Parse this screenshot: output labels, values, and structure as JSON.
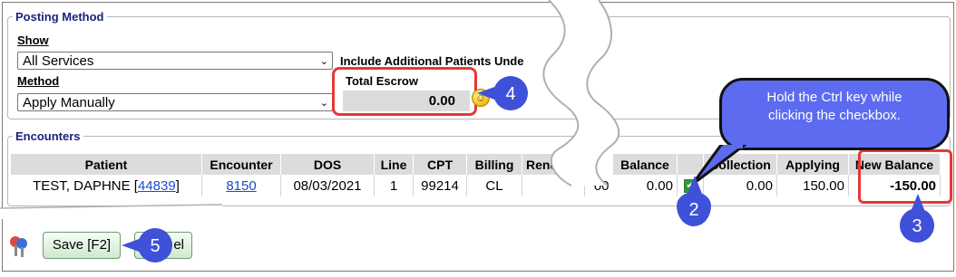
{
  "posting_method": {
    "legend": "Posting Method",
    "show_label": "Show",
    "show_value": "All Services",
    "method_label": "Method",
    "method_value": "Apply Manually",
    "include_label": "Include Additional Patients Unde",
    "total_escrow_label": "Total Escrow",
    "total_escrow_value": "0.00"
  },
  "encounters": {
    "legend": "Encounters",
    "left_columns": [
      "Patient",
      "Encounter",
      "DOS",
      "Line",
      "CPT",
      "Billing",
      "Rend"
    ],
    "right_columns": [
      "Balance",
      "",
      "Collection",
      "Applying",
      "New Balance"
    ],
    "row": {
      "patient_name": "TEST, DAPHNE [",
      "patient_id": "44839",
      "patient_close": "]",
      "encounter": "8150",
      "dos": "08/03/2021",
      "line": "1",
      "cpt": "99214",
      "billing": "CL",
      "rend": "",
      "cut_value": "00",
      "balance": "0.00",
      "checked": true,
      "collection": "0.00",
      "applying": "150.00",
      "new_balance": "-150.00"
    }
  },
  "callout": {
    "text": "Hold the Ctrl key while clicking the checkbox."
  },
  "markers": [
    "2",
    "3",
    "4",
    "5"
  ],
  "buttons": {
    "save": "Save [F2]",
    "cancel_partial": "el"
  },
  "colors": {
    "marker_blue": "#3f51d8",
    "highlight_red": "#e53935",
    "legend_navy": "#1a237e"
  }
}
